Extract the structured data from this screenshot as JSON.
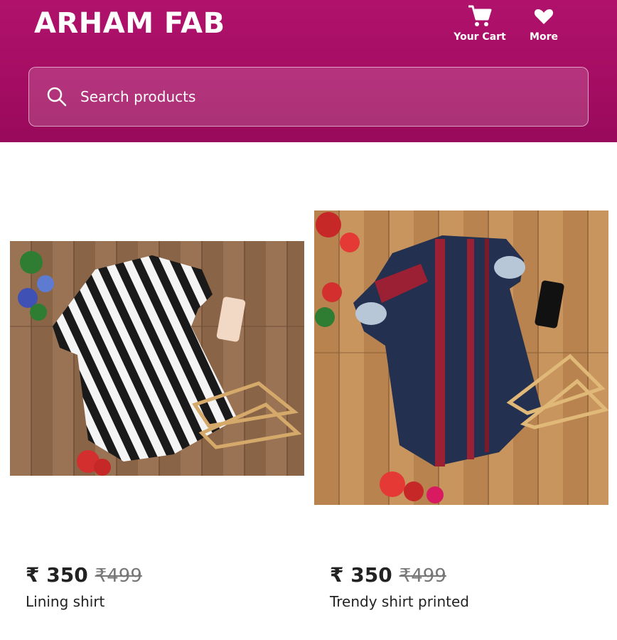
{
  "header": {
    "brand": "ARHAM FAB",
    "cart_label": "Your Cart",
    "more_label": "More",
    "search_placeholder": "Search products"
  },
  "products": [
    {
      "price": "₹ 350",
      "mrp": "₹499",
      "name": "Lining shirt"
    },
    {
      "price": "₹ 350",
      "mrp": "₹499",
      "name": "Trendy shirt printed"
    }
  ],
  "colors": {
    "header_bg": "#a40c62",
    "text": "#222222",
    "strikethrough_price": "#777777"
  },
  "icons": [
    "cart-icon",
    "heart-icon",
    "search-icon"
  ]
}
